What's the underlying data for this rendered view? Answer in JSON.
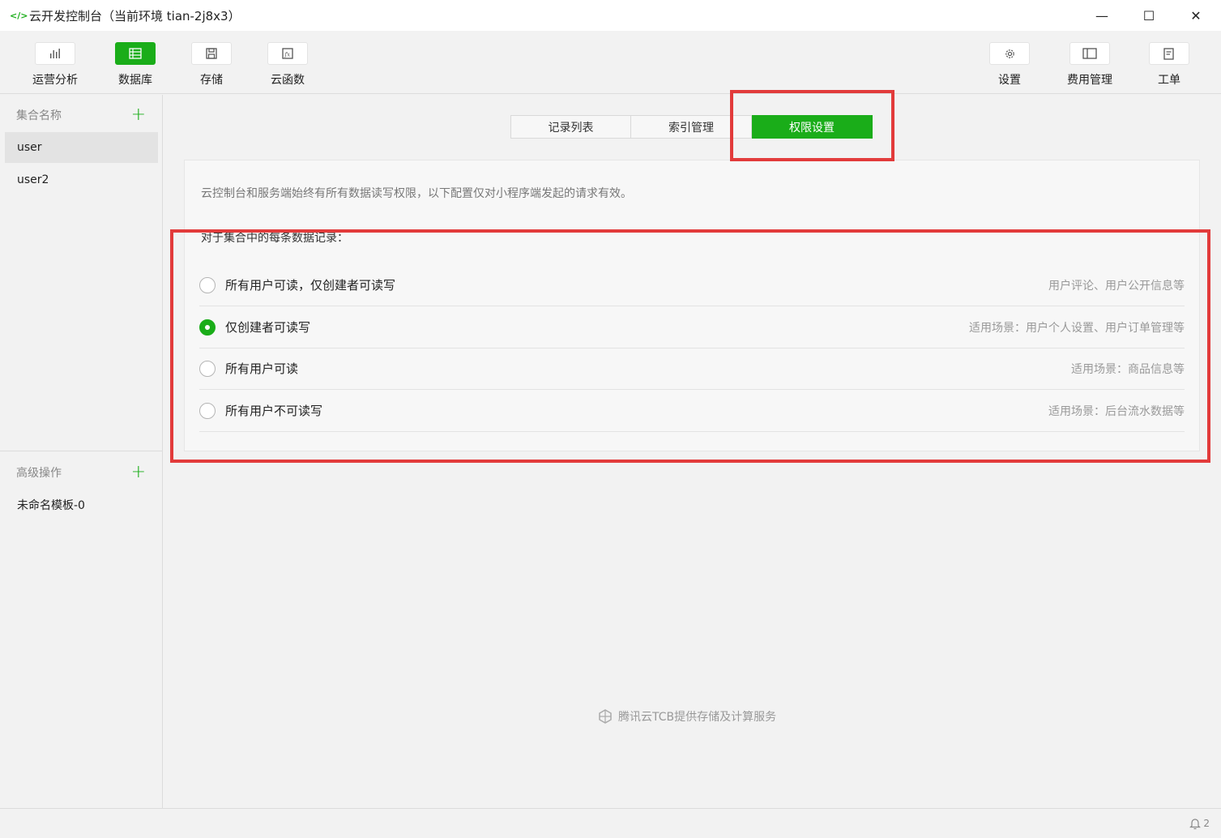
{
  "window": {
    "title": "云开发控制台（当前环境 tian-2j8x3）",
    "controls": {
      "minimize": "—",
      "maximize": "☐",
      "close": "✕"
    }
  },
  "toolbar": {
    "left": [
      {
        "label": "运营分析",
        "icon": "bar-chart-icon",
        "active": false
      },
      {
        "label": "数据库",
        "icon": "database-icon",
        "active": true
      },
      {
        "label": "存储",
        "icon": "save-icon",
        "active": false
      },
      {
        "label": "云函数",
        "icon": "function-icon",
        "active": false
      }
    ],
    "right": [
      {
        "label": "设置",
        "icon": "gear-icon"
      },
      {
        "label": "费用管理",
        "icon": "billing-icon"
      },
      {
        "label": "工单",
        "icon": "ticket-icon"
      }
    ]
  },
  "sidebar": {
    "collections_header": "集合名称",
    "collections": [
      {
        "label": "user",
        "selected": true
      },
      {
        "label": "user2",
        "selected": false
      }
    ],
    "advanced_header": "高级操作",
    "advanced_items": [
      {
        "label": "未命名模板-0"
      }
    ]
  },
  "tabs": [
    {
      "label": "记录列表",
      "active": false
    },
    {
      "label": "索引管理",
      "active": false
    },
    {
      "label": "权限设置",
      "active": true
    }
  ],
  "permissions": {
    "note": "云控制台和服务端始终有所有数据读写权限，以下配置仅对小程序端发起的请求有效。",
    "subhead": "对于集合中的每条数据记录：",
    "options": [
      {
        "label": "所有用户可读，仅创建者可读写",
        "hint": "用户评论、用户公开信息等",
        "checked": false
      },
      {
        "label": "仅创建者可读写",
        "hint": "适用场景：用户个人设置、用户订单管理等",
        "checked": true
      },
      {
        "label": "所有用户可读",
        "hint": "适用场景：商品信息等",
        "checked": false
      },
      {
        "label": "所有用户不可读写",
        "hint": "适用场景：后台流水数据等",
        "checked": false
      }
    ]
  },
  "footer": {
    "credit": "腾讯云TCB提供存储及计算服务",
    "notification_count": "2"
  },
  "colors": {
    "accent": "#1aad19",
    "highlight": "#e23b3b"
  }
}
